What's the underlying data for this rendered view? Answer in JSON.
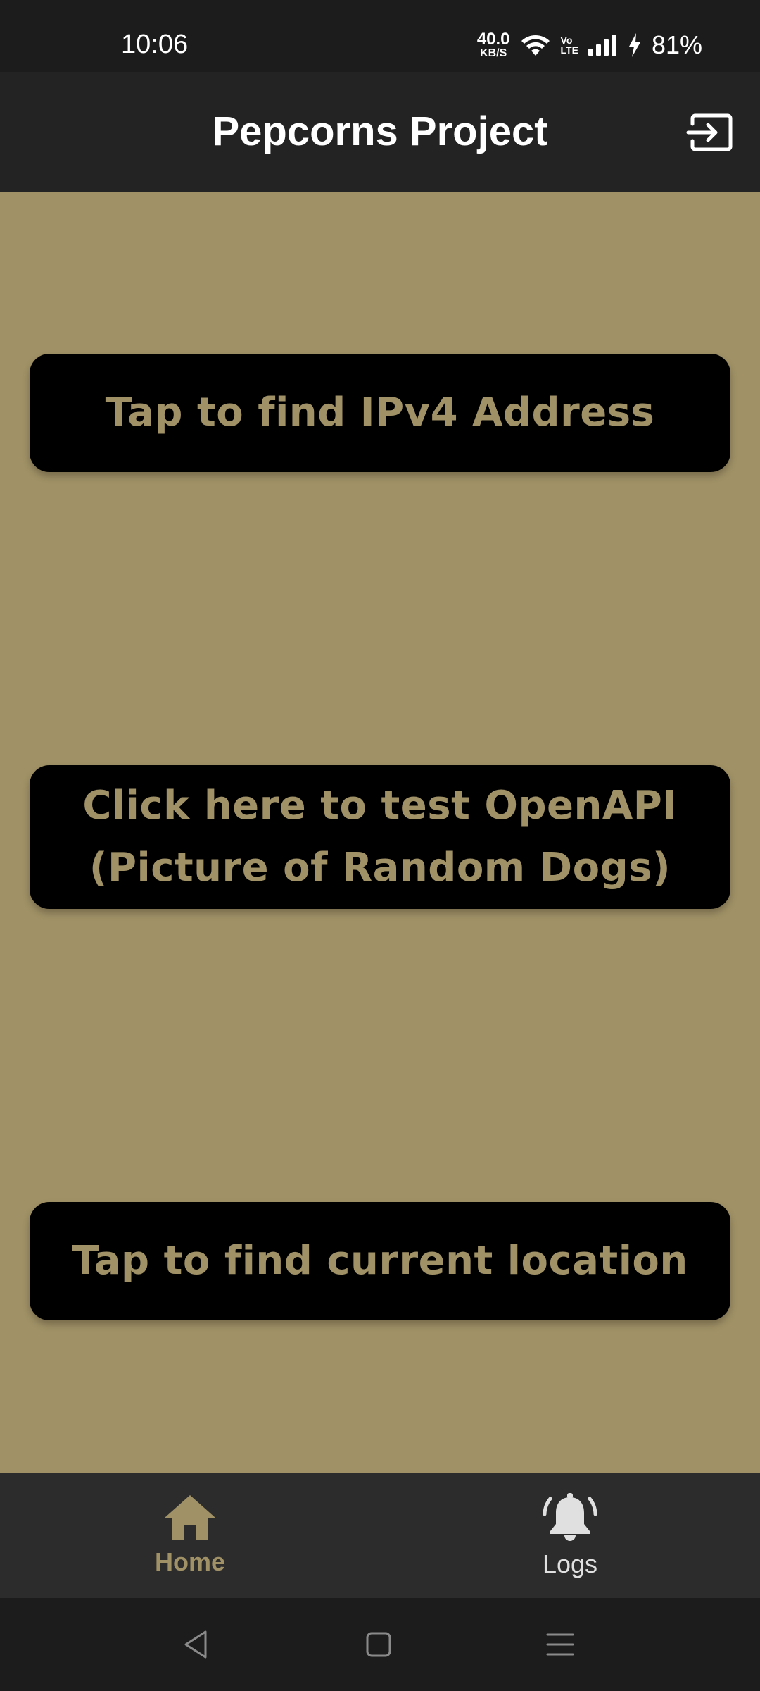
{
  "status_bar": {
    "time": "10:06",
    "net_speed_value": "40.0",
    "net_speed_unit": "KB/S",
    "volte_top": "Vo",
    "volte_bottom": "LTE",
    "battery": "81%",
    "icons": [
      "wifi-icon",
      "volte-icon",
      "signal-icon",
      "charging-icon"
    ]
  },
  "app_bar": {
    "title": "Pepcorns Project",
    "logout_icon": "logout-icon"
  },
  "main": {
    "ipv4_button": "Tap to find IPv4 Address",
    "openapi_button_line1": "Click here to test OpenAPI",
    "openapi_button_line2": "(Picture of Random Dogs)",
    "location_button": "Tap to find current location"
  },
  "bottom_nav": {
    "items": [
      {
        "label": "Home",
        "icon": "home-icon",
        "active": true
      },
      {
        "label": "Logs",
        "icon": "bell-icon",
        "active": false
      }
    ]
  },
  "system_nav": {
    "icons": [
      "back-icon",
      "home-square-icon",
      "menu-icon"
    ]
  },
  "colors": {
    "accent": "#a09166",
    "background": "#a09166",
    "button": "#000000",
    "app_bar": "#232323",
    "bottom_nav": "#2c2c2c",
    "status_bar": "#1c1c1c"
  }
}
